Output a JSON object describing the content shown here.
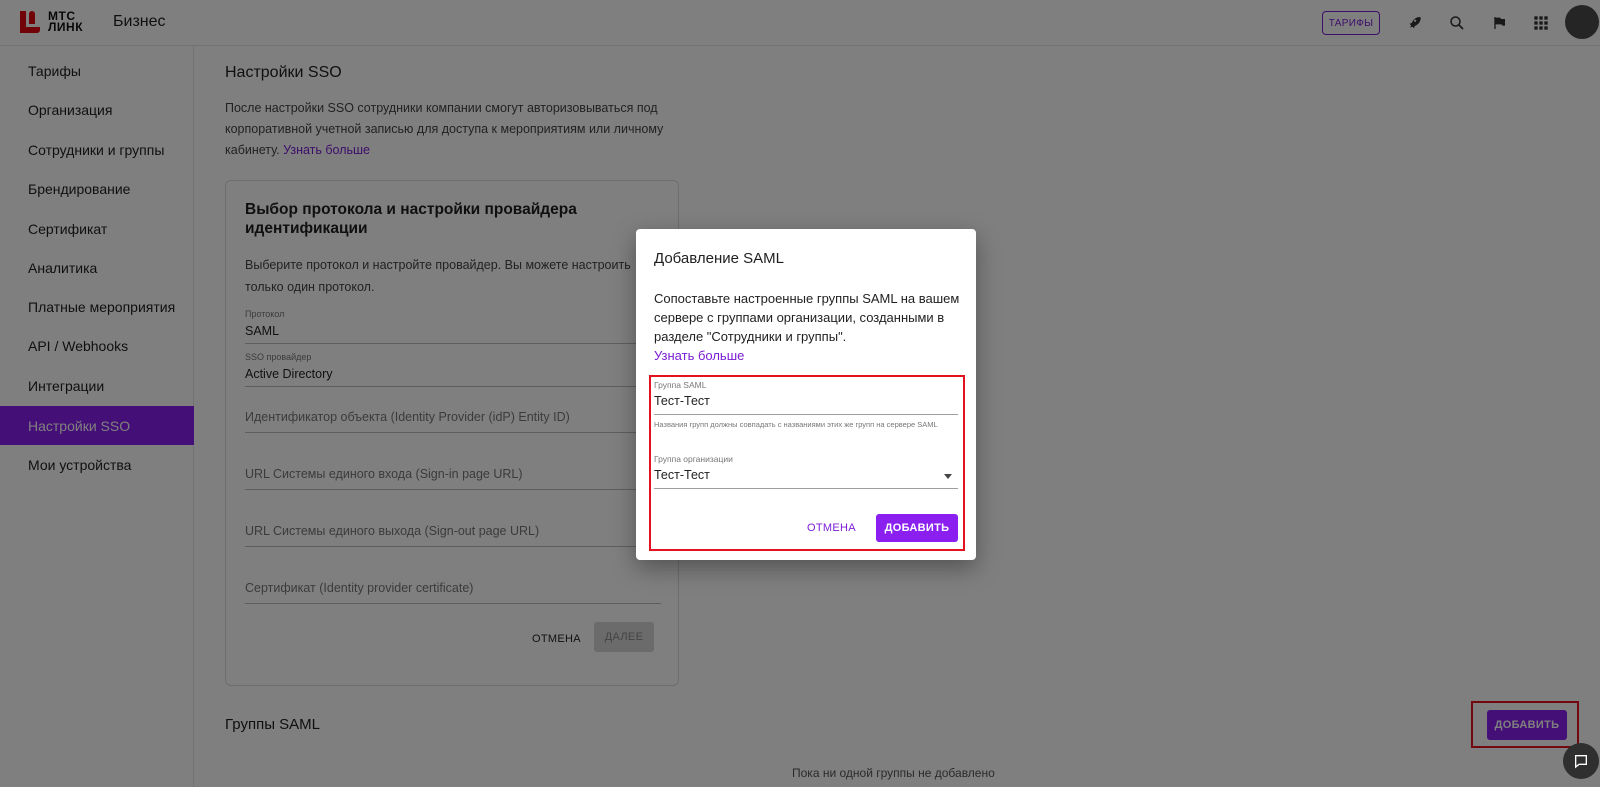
{
  "header": {
    "logo_line1": "МТС",
    "logo_line2": "ЛИНК",
    "product": "Бизнес",
    "tariffs_button": "ТАРИФЫ",
    "icons": [
      "rocket-icon",
      "search-icon",
      "flag-icon",
      "apps-grid-icon",
      "avatar"
    ]
  },
  "sidebar": {
    "items": [
      {
        "label": "Тарифы"
      },
      {
        "label": "Организация"
      },
      {
        "label": "Сотрудники и группы"
      },
      {
        "label": "Брендирование"
      },
      {
        "label": "Сертификат"
      },
      {
        "label": "Аналитика"
      },
      {
        "label": "Платные мероприятия"
      },
      {
        "label": "API / Webhooks"
      },
      {
        "label": "Интеграции"
      },
      {
        "label": "Настройки SSO",
        "active": true
      },
      {
        "label": "Мои устройства"
      }
    ]
  },
  "main": {
    "title": "Настройки SSO",
    "description": "После настройки SSO сотрудники компании смогут авторизовываться под корпоративной учетной записью для доступа к мероприятиям или личному кабинету. ",
    "learn_more": "Узнать больше",
    "card": {
      "title": "Выбор протокола и настройки провайдера идентификации",
      "description": "Выберите протокол и настройте провайдер. Вы можете настроить только один протокол.",
      "protocol_label": "Протокол",
      "protocol_value": "SAML",
      "sso_provider_label": "SSO провайдер",
      "sso_provider_value": "Active Directory",
      "entity_id_placeholder": "Идентификатор объекта (Identity Provider (idP) Entity ID)",
      "signin_url_placeholder": "URL Системы единого входа (Sign-in page URL)",
      "signout_url_placeholder": "URL Системы единого выхода (Sign-out page URL)",
      "certificate_placeholder": "Сертификат (Identity provider certificate)",
      "cancel_label": "ОТМЕНА",
      "next_label": "ДАЛЕЕ"
    },
    "groups_title": "Группы SAML",
    "add_label": "ДОБАВИТЬ",
    "empty_note": "Пока ни одной группы не добавлено"
  },
  "dialog": {
    "title": "Добавление SAML",
    "description": "Сопоставьте настроенные группы SAML на вашем сервере с группами организации, созданными в разделе \"Сотрудники и группы\".",
    "learn_more": "Узнать больше",
    "saml_group_label": "Группа SAML",
    "saml_group_value": "Тест-Тест",
    "hint": "Названия групп должны совпадать с названиями этих же групп на сервере SAML",
    "org_group_label": "Группа организации",
    "org_group_value": "Тест-Тест",
    "cancel_label": "ОТМЕНА",
    "add_label": "ДОБАВИТЬ"
  },
  "colors": {
    "accent": "#8a1ff0",
    "brand_red": "#e30611",
    "highlight": "#e4121e"
  }
}
